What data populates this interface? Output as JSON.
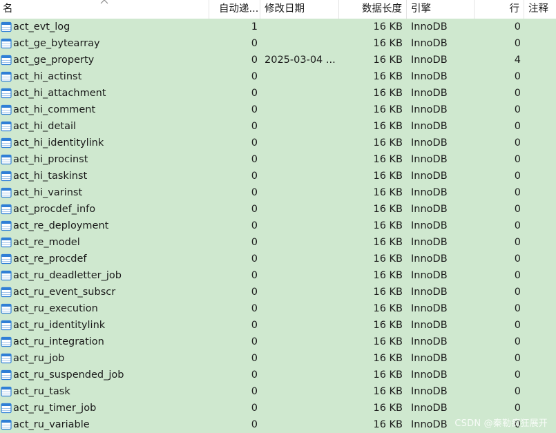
{
  "columns": {
    "name": "名",
    "auto_increment": "自动递...",
    "modified_date": "修改日期",
    "data_length": "数据长度",
    "engine": "引擎",
    "rows": "行",
    "comment": "注释"
  },
  "rows": [
    {
      "name": "act_evt_log",
      "auto": "1",
      "date": "",
      "size": "16 KB",
      "engine": "InnoDB",
      "rows": "0"
    },
    {
      "name": "act_ge_bytearray",
      "auto": "0",
      "date": "",
      "size": "16 KB",
      "engine": "InnoDB",
      "rows": "0"
    },
    {
      "name": "act_ge_property",
      "auto": "0",
      "date": "2025-03-04 ...",
      "size": "16 KB",
      "engine": "InnoDB",
      "rows": "4"
    },
    {
      "name": "act_hi_actinst",
      "auto": "0",
      "date": "",
      "size": "16 KB",
      "engine": "InnoDB",
      "rows": "0"
    },
    {
      "name": "act_hi_attachment",
      "auto": "0",
      "date": "",
      "size": "16 KB",
      "engine": "InnoDB",
      "rows": "0"
    },
    {
      "name": "act_hi_comment",
      "auto": "0",
      "date": "",
      "size": "16 KB",
      "engine": "InnoDB",
      "rows": "0"
    },
    {
      "name": "act_hi_detail",
      "auto": "0",
      "date": "",
      "size": "16 KB",
      "engine": "InnoDB",
      "rows": "0"
    },
    {
      "name": "act_hi_identitylink",
      "auto": "0",
      "date": "",
      "size": "16 KB",
      "engine": "InnoDB",
      "rows": "0"
    },
    {
      "name": "act_hi_procinst",
      "auto": "0",
      "date": "",
      "size": "16 KB",
      "engine": "InnoDB",
      "rows": "0"
    },
    {
      "name": "act_hi_taskinst",
      "auto": "0",
      "date": "",
      "size": "16 KB",
      "engine": "InnoDB",
      "rows": "0"
    },
    {
      "name": "act_hi_varinst",
      "auto": "0",
      "date": "",
      "size": "16 KB",
      "engine": "InnoDB",
      "rows": "0"
    },
    {
      "name": "act_procdef_info",
      "auto": "0",
      "date": "",
      "size": "16 KB",
      "engine": "InnoDB",
      "rows": "0"
    },
    {
      "name": "act_re_deployment",
      "auto": "0",
      "date": "",
      "size": "16 KB",
      "engine": "InnoDB",
      "rows": "0"
    },
    {
      "name": "act_re_model",
      "auto": "0",
      "date": "",
      "size": "16 KB",
      "engine": "InnoDB",
      "rows": "0"
    },
    {
      "name": "act_re_procdef",
      "auto": "0",
      "date": "",
      "size": "16 KB",
      "engine": "InnoDB",
      "rows": "0"
    },
    {
      "name": "act_ru_deadletter_job",
      "auto": "0",
      "date": "",
      "size": "16 KB",
      "engine": "InnoDB",
      "rows": "0"
    },
    {
      "name": "act_ru_event_subscr",
      "auto": "0",
      "date": "",
      "size": "16 KB",
      "engine": "InnoDB",
      "rows": "0"
    },
    {
      "name": "act_ru_execution",
      "auto": "0",
      "date": "",
      "size": "16 KB",
      "engine": "InnoDB",
      "rows": "0"
    },
    {
      "name": "act_ru_identitylink",
      "auto": "0",
      "date": "",
      "size": "16 KB",
      "engine": "InnoDB",
      "rows": "0"
    },
    {
      "name": "act_ru_integration",
      "auto": "0",
      "date": "",
      "size": "16 KB",
      "engine": "InnoDB",
      "rows": "0"
    },
    {
      "name": "act_ru_job",
      "auto": "0",
      "date": "",
      "size": "16 KB",
      "engine": "InnoDB",
      "rows": "0"
    },
    {
      "name": "act_ru_suspended_job",
      "auto": "0",
      "date": "",
      "size": "16 KB",
      "engine": "InnoDB",
      "rows": "0"
    },
    {
      "name": "act_ru_task",
      "auto": "0",
      "date": "",
      "size": "16 KB",
      "engine": "InnoDB",
      "rows": "0"
    },
    {
      "name": "act_ru_timer_job",
      "auto": "0",
      "date": "",
      "size": "16 KB",
      "engine": "InnoDB",
      "rows": "0"
    },
    {
      "name": "act_ru_variable",
      "auto": "0",
      "date": "",
      "size": "16 KB",
      "engine": "InnoDB",
      "rows": "0"
    }
  ],
  "watermark": "CSDN @秦勒疯狂展开",
  "colors": {
    "row_bg": "#cfe8cf",
    "icon_blue": "#2f7fd6"
  },
  "icons": {
    "table": "table-icon",
    "sort": "sort-up-icon"
  }
}
